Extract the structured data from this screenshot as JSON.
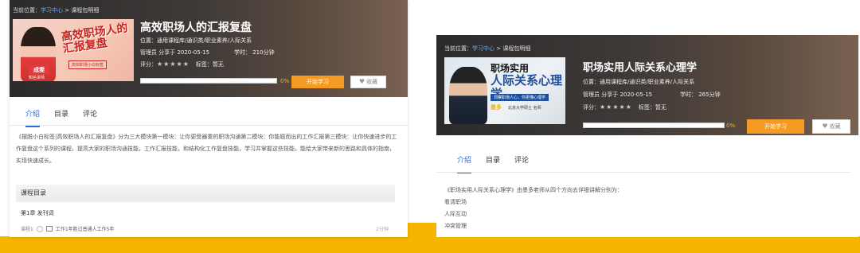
{
  "left": {
    "breadcrumb": {
      "prefix": "当前位置：",
      "link": "学习中心",
      "sep": " > ",
      "current": "课程包明细"
    },
    "thumbnail": {
      "title": "高效职场人的汇报复盘",
      "tag": "高效职场小白标签",
      "name": "成雯",
      "sub": "知名讲师"
    },
    "course_title": "高效职场人的汇报复盘",
    "location": "位置：通用课程库/通识类/职业素养/人际关系",
    "manager": "管理员 分享于 2020-05-15",
    "hours": "学时： 210分钟",
    "rating_label": "评分：",
    "stars": "★★★★★",
    "tags": "标签：暂无",
    "progress": 0,
    "progress_text": "0%",
    "start_button": "开始学习",
    "fav_button": "收藏",
    "tabs": [
      "介绍",
      "目录",
      "评论"
    ],
    "description": "《摆脱小白标签|高效职场人的汇报复盘》分为三大模块第一模块：让你更受器重的职场沟通第二模块：你能题而出的工作汇报第三模块：让你快速进步的工作复盘这个系列的课程，提高大家的职场沟通技能，工作汇报技能，和结构化工作复盘技能，学习并掌握这些技能，能给大家带来新的思路和具体的指南，实现快速成长。",
    "catalog_title": "课程目录",
    "chapter": "第1章 发刊词",
    "lesson": {
      "label": "课程1",
      "title": "工作1年胜过普通人工作5年",
      "duration": "2分钟"
    }
  },
  "right": {
    "breadcrumb": {
      "prefix": "当前位置：",
      "link": "学习中心",
      "sep": " > ",
      "current": "课程包明细"
    },
    "thumbnail": {
      "line1": "职场实用",
      "line2": "人际关系心理学",
      "tag": "洞察职场人心，你更懂心理学",
      "name": "墨多",
      "sub": "北京大学硕士 名师"
    },
    "course_title": "职场实用人际关系心理学",
    "location": "位置：通用课程库/通识类/职业素养/人际关系",
    "manager": "管理员 分享于 2020-05-15",
    "hours": "学时： 265分钟",
    "rating_label": "评分：",
    "stars": "★★★★★",
    "tags": "标签：暂无",
    "progress": 0,
    "progress_text": "0%",
    "start_button": "开始学习",
    "fav_button": "收藏",
    "tabs": [
      "介绍",
      "目录",
      "评论"
    ],
    "description_lines": [
      "《职场实用人际关系心理学》由墨多老师从四个方向去详细讲解分别为：",
      "看清职场",
      "人际互动",
      "冲突管理"
    ]
  }
}
